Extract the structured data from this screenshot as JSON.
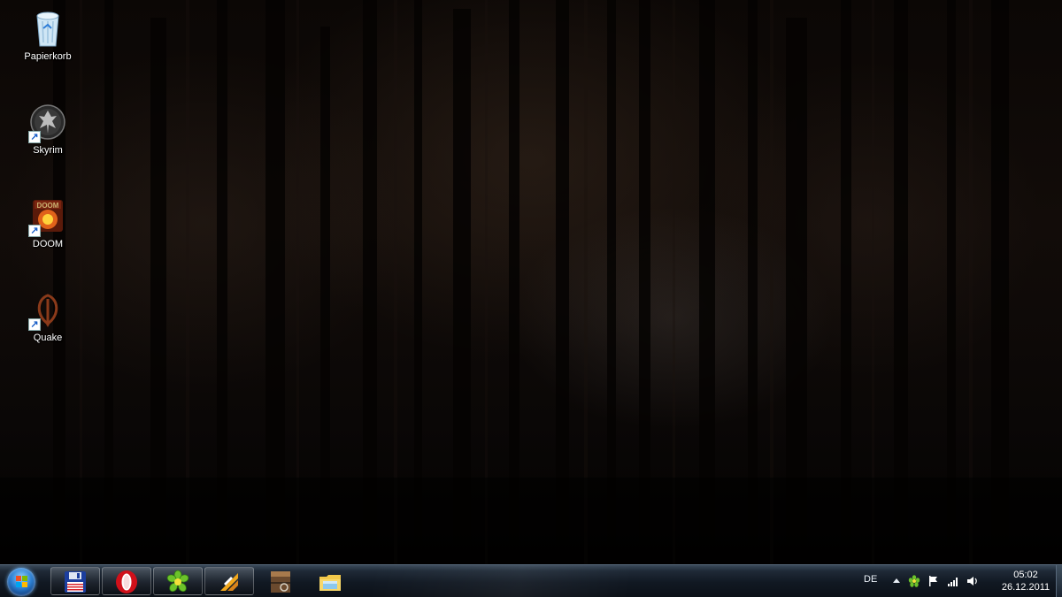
{
  "desktop": {
    "icons": [
      {
        "label": "Papierkorb",
        "icon": "recycle-bin-icon",
        "shortcut": false
      },
      {
        "label": "Skyrim",
        "icon": "skyrim-icon",
        "shortcut": true
      },
      {
        "label": "DOOM",
        "icon": "doom-icon",
        "shortcut": true
      },
      {
        "label": "Quake",
        "icon": "quake-icon",
        "shortcut": true
      }
    ]
  },
  "taskbar": {
    "start_icon": "windows-orb-icon",
    "pinned": [
      {
        "name": "floppy-save-app",
        "icon": "floppy-disk-icon"
      },
      {
        "name": "opera",
        "icon": "opera-icon"
      },
      {
        "name": "icq",
        "icon": "icq-flower-icon"
      },
      {
        "name": "winamp",
        "icon": "winamp-icon"
      },
      {
        "name": "game-app",
        "icon": "game-box-icon"
      },
      {
        "name": "explorer",
        "icon": "folder-icon"
      }
    ],
    "tray": {
      "language": "DE",
      "icons": [
        "show-hidden-icons-arrow",
        "icq-tray-icon",
        "action-center-flag-icon",
        "network-signal-icon",
        "volume-icon"
      ],
      "time": "05:02",
      "date": "26.12.2011"
    }
  },
  "colors": {
    "taskbar": "#111822",
    "opera_red": "#d0101a",
    "icq_green": "#6cc22a",
    "clock_text": "#ffffff"
  }
}
